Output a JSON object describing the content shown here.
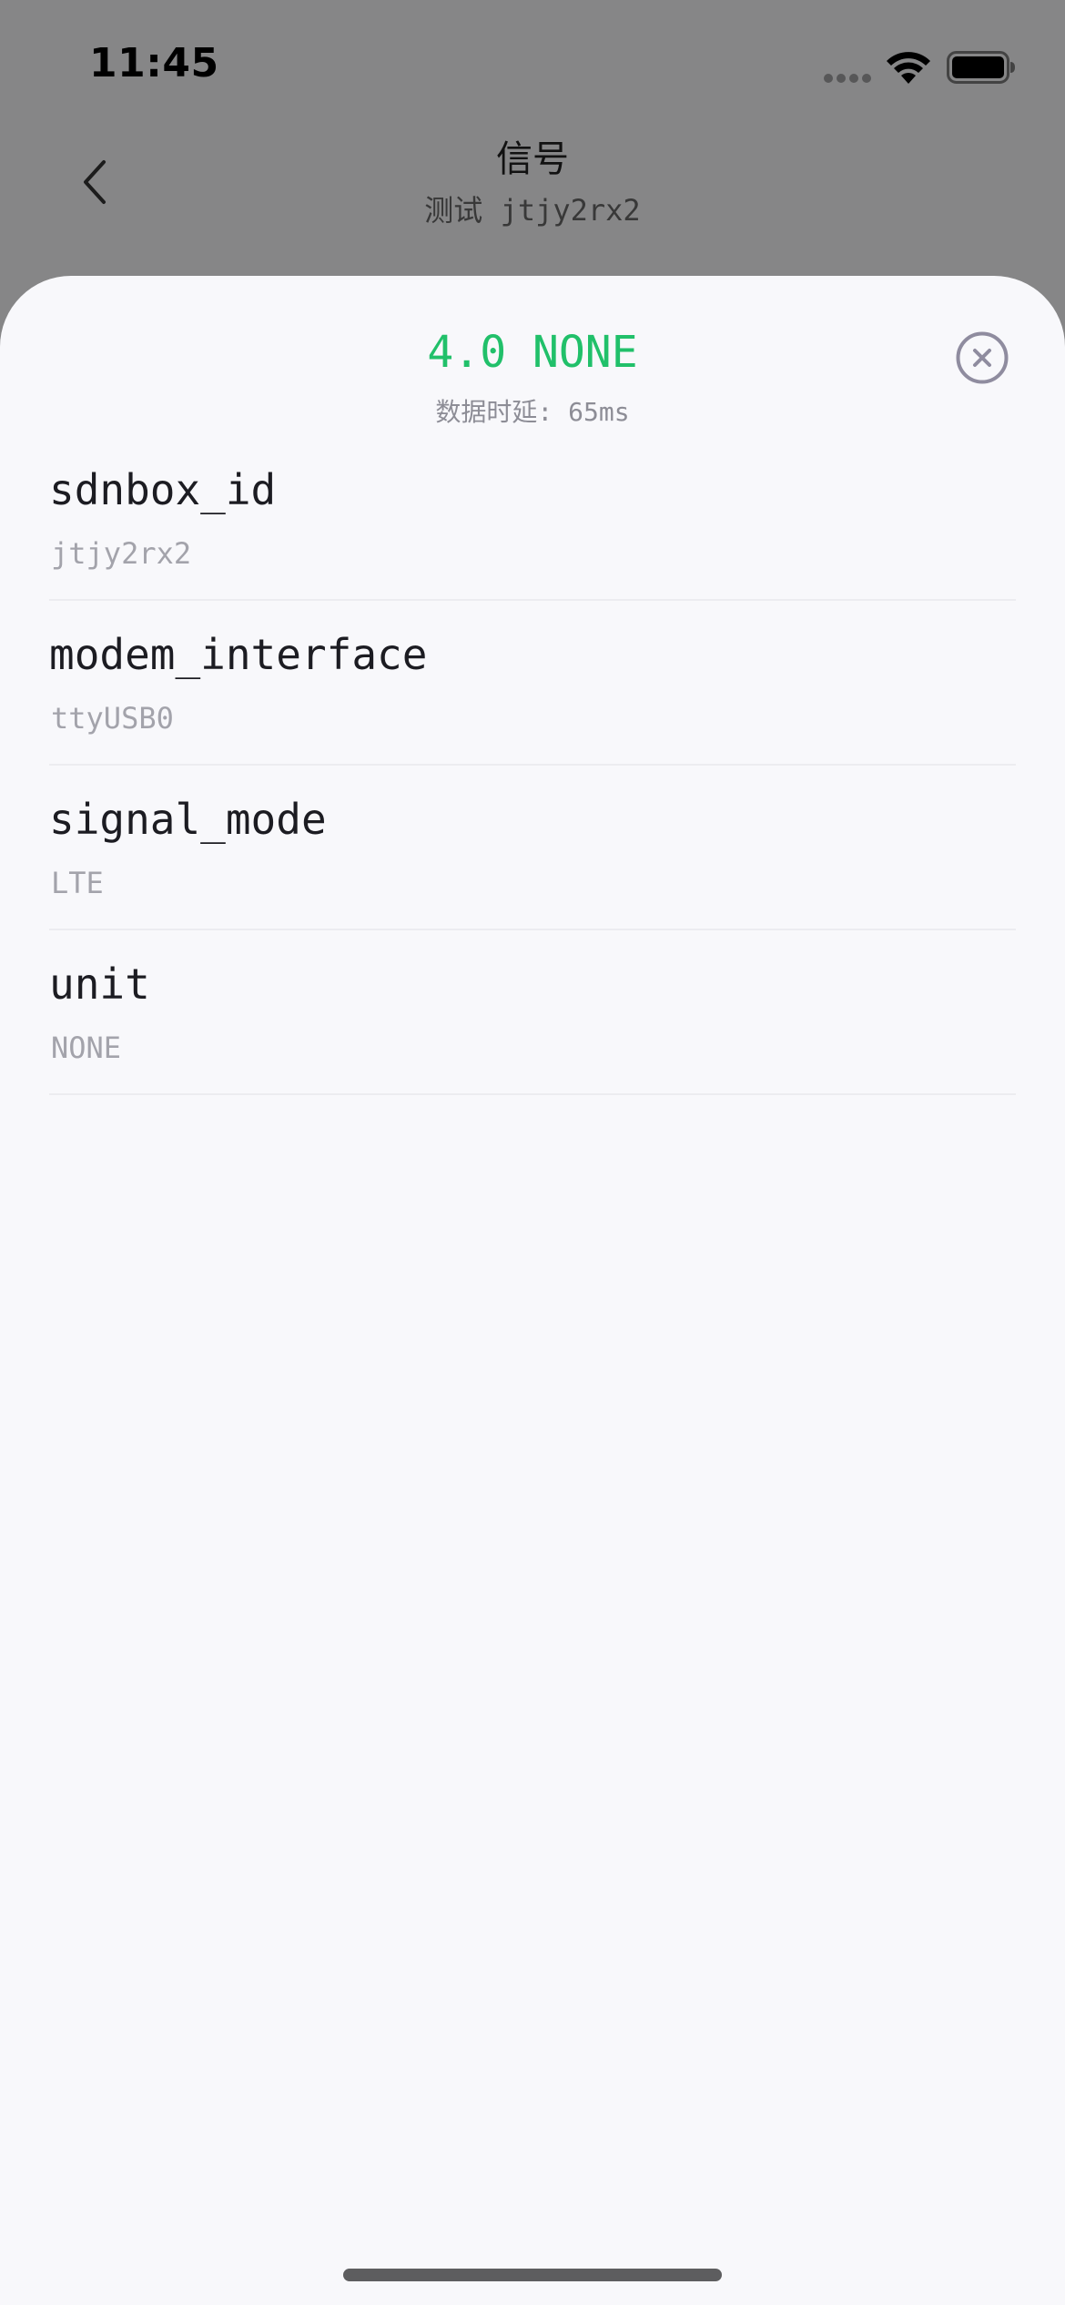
{
  "status_bar": {
    "time": "11:45"
  },
  "nav": {
    "title": "信号",
    "subtitle": "测试 jtjy2rx2"
  },
  "sheet": {
    "title": "4.0 NONE",
    "subtitle": "数据时延: 65ms",
    "accent_color": "#21c06a",
    "items": [
      {
        "key": "sdnbox_id",
        "value": "jtjy2rx2"
      },
      {
        "key": "modem_interface",
        "value": "ttyUSB0"
      },
      {
        "key": "signal_mode",
        "value": "LTE"
      },
      {
        "key": "unit",
        "value": "NONE"
      }
    ]
  },
  "icons": {
    "back": "chevron-left-icon",
    "close": "close-circle-icon",
    "wifi": "wifi-icon",
    "battery": "battery-icon",
    "cellular": "cellular-dots-icon"
  }
}
